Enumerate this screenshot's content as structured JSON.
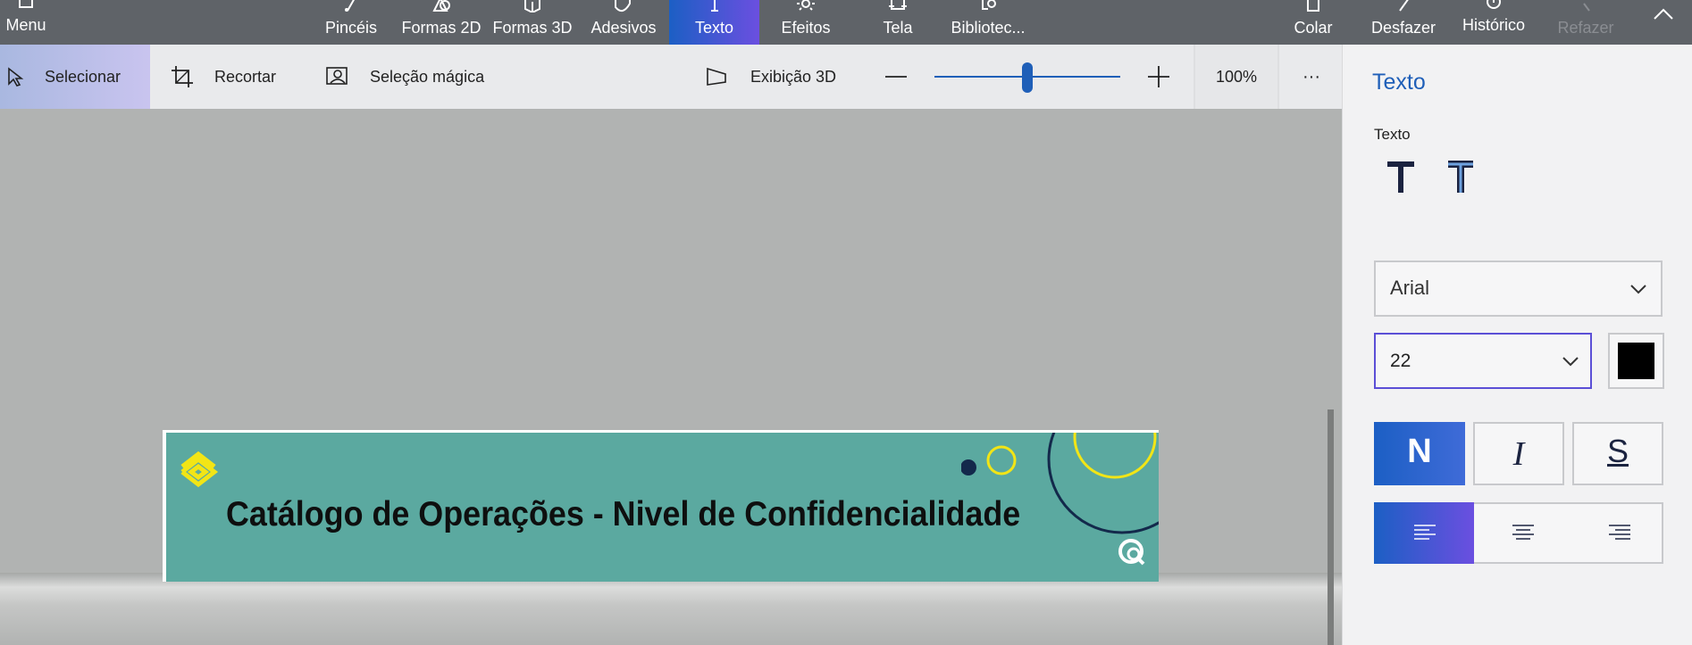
{
  "topbar": {
    "menu_label": "Menu",
    "tabs": [
      {
        "label": "Pincéis",
        "icon": "brush-icon"
      },
      {
        "label": "Formas 2D",
        "icon": "shapes-2d-icon"
      },
      {
        "label": "Formas 3D",
        "icon": "cube-icon"
      },
      {
        "label": "Adesivos",
        "icon": "sticker-icon"
      },
      {
        "label": "Texto",
        "icon": "text-icon"
      },
      {
        "label": "Efeitos",
        "icon": "sun-icon"
      },
      {
        "label": "Tela",
        "icon": "canvas-icon"
      },
      {
        "label": "Bibliotec...",
        "icon": "library-icon"
      }
    ],
    "actions": [
      {
        "label": "Colar",
        "icon": "paste-icon"
      },
      {
        "label": "Desfazer",
        "icon": "undo-icon"
      },
      {
        "label": "Histórico",
        "icon": "history-icon"
      },
      {
        "label": "Refazer",
        "icon": "redo-icon"
      }
    ],
    "active_color": "#1c5fc4"
  },
  "toolbar": {
    "select": "Selecionar",
    "crop": "Recortar",
    "magic_select": "Seleção mágica",
    "view3d": "Exibição 3D",
    "zoom": "100%",
    "zoom_level": 0.5,
    "more": "···"
  },
  "canvas": {
    "banner_title": "Catálogo de Operações - Nivel de Confidencialidade",
    "banner_color": "#5ba9a0"
  },
  "panel": {
    "heading": "Texto",
    "sublabel": "Texto",
    "font": "Arial",
    "size": "22",
    "color": "#000000",
    "bold": "N",
    "italic": "I",
    "underline": "S"
  }
}
